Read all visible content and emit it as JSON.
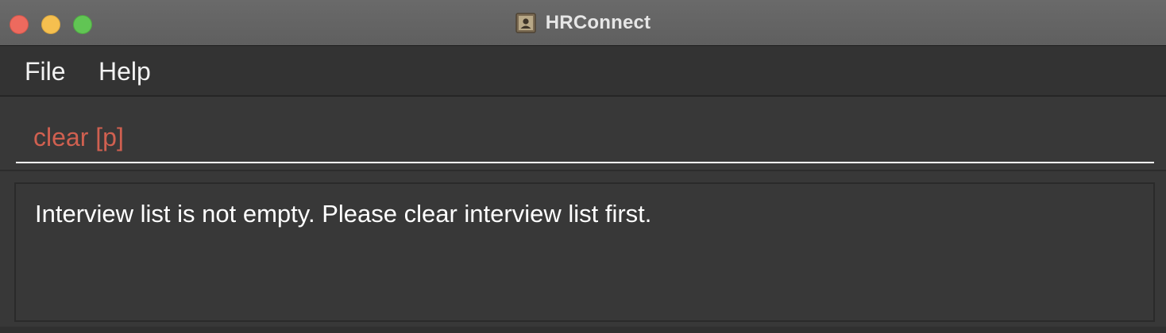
{
  "window": {
    "title": "HRConnect",
    "app_icon": "contact-card-icon"
  },
  "menu": {
    "items": [
      {
        "label": "File"
      },
      {
        "label": "Help"
      }
    ]
  },
  "command_box": {
    "value": "clear [p]",
    "text_color": "#d06050"
  },
  "result_display": {
    "message": "Interview list is not empty. Please clear interview list first."
  },
  "colors": {
    "close": "#ed6a5e",
    "minimize": "#f5bf4f",
    "zoom": "#61c554",
    "background": "#383838"
  }
}
